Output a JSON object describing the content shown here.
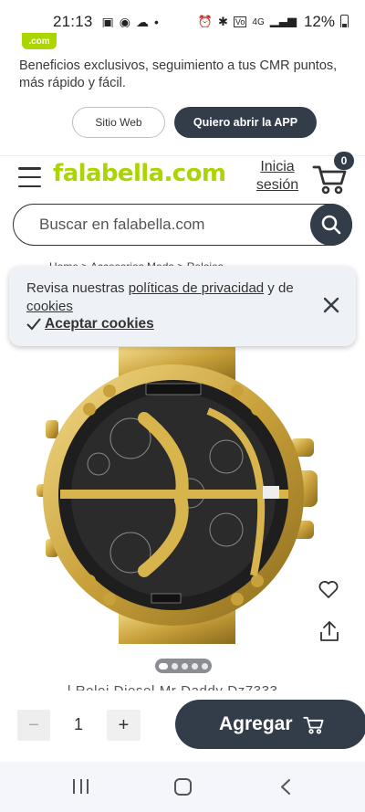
{
  "status_bar": {
    "time": "21:13",
    "battery": "12%",
    "network": "4G"
  },
  "app_banner": {
    "logo_text": ".com",
    "text": "Beneficios exclusivos, seguimiento a tus CMR puntos, más rápido y fácil.",
    "web_button": "Sitio Web",
    "app_button": "Quiero abrir la APP"
  },
  "header": {
    "logo": "falabella.com",
    "login_line1": "Inicia",
    "login_line2": "sesión",
    "cart_count": "0",
    "search_placeholder": "Buscar en falabella.com"
  },
  "breadcrumb": "Home  >  Accesorios Moda  >  Relojes",
  "cookie_banner": {
    "text_prefix": "Revisa nuestras ",
    "privacy_link": "políticas de privacidad",
    "text_middle": " y de ",
    "cookies_link": "cookies",
    "accept_label": "Aceptar cookies"
  },
  "product": {
    "title_partial": "l Reloj Diesel Mr Daddy Dz7333",
    "image_pager_count": 5,
    "image_pager_active": 1
  },
  "add_bar": {
    "minus": "−",
    "quantity": "1",
    "plus": "+",
    "add_label": "Agregar"
  },
  "colors": {
    "brand_green": "#aad500",
    "dark_button": "#333d4a",
    "cookie_bg": "#eef1f5"
  }
}
